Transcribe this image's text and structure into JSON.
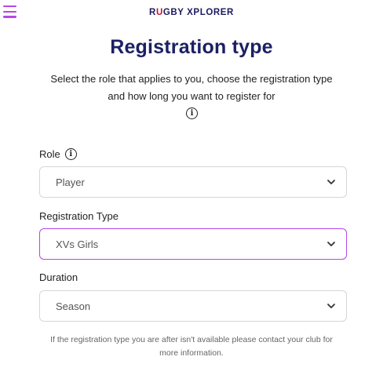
{
  "header": {
    "menu_icon": "hamburger-menu-icon",
    "logo_part1": "R",
    "logo_part2": "U",
    "logo_part3": "GBY XPLORER"
  },
  "page": {
    "title": "Registration type",
    "subtitle": "Select the role that applies to you, choose the registration type and how long you want to register for",
    "info_icon": "info-circle-icon",
    "info_glyph": "i"
  },
  "fields": {
    "role": {
      "label": "Role",
      "value": "Player"
    },
    "registration_type": {
      "label": "Registration Type",
      "value": "XVs Girls"
    },
    "duration": {
      "label": "Duration",
      "value": "Season"
    }
  },
  "footnote": "If the registration type you are after isn't available please contact your club for more information.",
  "colors": {
    "accent": "#b845e6",
    "title": "#1c2163",
    "logo": "#1a1a5e"
  }
}
